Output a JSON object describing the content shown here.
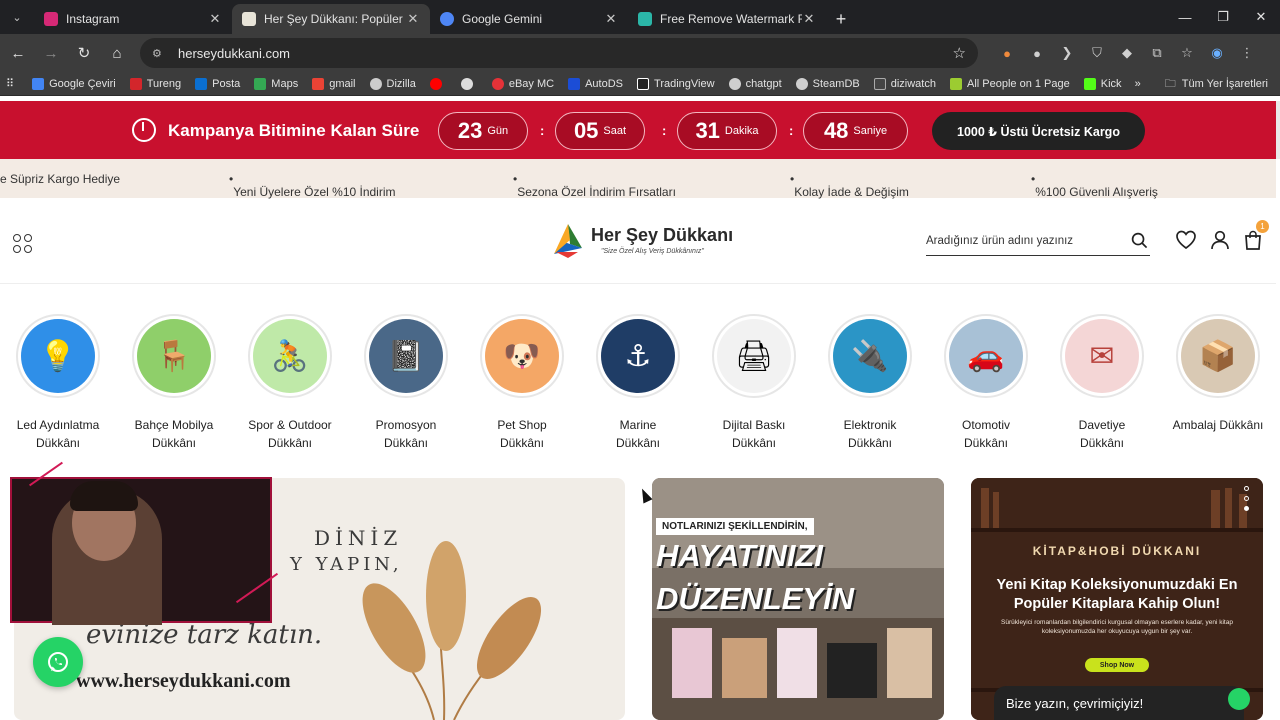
{
  "browser": {
    "tabs": [
      {
        "title": "Instagram",
        "favicon_color": "#d62976",
        "active": false
      },
      {
        "title": "Her Şey Dükkanı: Popüler Ürünl",
        "favicon_color": "#e8e4d8",
        "active": true
      },
      {
        "title": "Google Gemini",
        "favicon_color": "#4e86f5",
        "active": false
      },
      {
        "title": "Free Remove Watermark From",
        "favicon_color": "#2bb6a8",
        "active": false
      }
    ],
    "url": "herseydukkani.com",
    "bookmarks": [
      {
        "label": "Google Çeviri",
        "color": "#4285f4"
      },
      {
        "label": "Tureng",
        "color": "#d3262b"
      },
      {
        "label": "Posta",
        "color": "#0a6fd1"
      },
      {
        "label": "Maps",
        "color": "#34a853"
      },
      {
        "label": "gmail",
        "color": "#ea4335"
      },
      {
        "label": "Dizilla",
        "color": "#cccccc"
      },
      {
        "label": "",
        "color": "#ff0000"
      },
      {
        "label": "",
        "color": "#dddddd"
      },
      {
        "label": "eBay MC",
        "color": "#e53238"
      },
      {
        "label": "AutoDS",
        "color": "#1b4dd6"
      },
      {
        "label": "TradingView",
        "color": "#222222"
      },
      {
        "label": "chatgpt",
        "color": "#cfcfcf"
      },
      {
        "label": "SteamDB",
        "color": "#cfcfcf"
      },
      {
        "label": "diziwatch",
        "color": "#444444"
      },
      {
        "label": "All People on 1 Page",
        "color": "#9ccc31"
      },
      {
        "label": "Kick",
        "color": "#53fc18"
      }
    ],
    "bookmarks_folder": "Tüm Yer İşaretleri"
  },
  "campaign": {
    "title": "Kampanya Bitimine Kalan Süre",
    "countdown": [
      {
        "value": "23",
        "unit": "Gün"
      },
      {
        "value": "05",
        "unit": "Saat"
      },
      {
        "value": "31",
        "unit": "Dakika"
      },
      {
        "value": "48",
        "unit": "Saniye"
      }
    ],
    "separator": ":",
    "shipping": "1000 ₺ Üstü Ücretsiz Kargo"
  },
  "marquee": [
    "e Süpriz Kargo Hediye",
    "Yeni Üyelere Özel %10 İndirim",
    "Sezona Özel İndirim Fırsatları",
    "Kolay İade & Değişim",
    "%100 Güvenli Alışveriş"
  ],
  "header": {
    "logo_name": "Her Şey Dükkanı",
    "logo_slogan": "\"Size Özel Alış Veriş Dükkânınız\"",
    "search_placeholder": "Aradığınız ürün adını yazınız",
    "cart_count": "1"
  },
  "categories": [
    {
      "line1": "Led Aydınlatma",
      "line2": "Dükkânı",
      "bg": "#2f8fe8",
      "glyph": "💡"
    },
    {
      "line1": "Bahçe Mobilya",
      "line2": "Dükkânı",
      "bg": "#8fcf6a",
      "glyph": "🪑"
    },
    {
      "line1": "Spor & Outdoor",
      "line2": "Dükkânı",
      "bg": "#bfe9a8",
      "glyph": "🚴"
    },
    {
      "line1": "Promosyon",
      "line2": "Dükkânı",
      "bg": "#4a6888",
      "glyph": "📓"
    },
    {
      "line1": "Pet Shop",
      "line2": "Dükkânı",
      "bg": "#f4a766",
      "glyph": "🐶"
    },
    {
      "line1": "Marine",
      "line2": "Dükkânı",
      "bg": "#1f3d66",
      "glyph": "⚓"
    },
    {
      "line1": "Dijital Baskı",
      "line2": "Dükkânı",
      "bg": "#f2f2f2",
      "glyph": "🖨"
    },
    {
      "line1": "Elektronik",
      "line2": "Dükkânı",
      "bg": "#2b95c6",
      "glyph": "🔌"
    },
    {
      "line1": "Otomotiv",
      "line2": "Dükkânı",
      "bg": "#a8c1d6",
      "glyph": "🚗"
    },
    {
      "line1": "Davetiye",
      "line2": "Dükkânı",
      "bg": "#f4d6d6",
      "glyph": "✉"
    },
    {
      "line1": "Ambalaj Dükkânı",
      "line2": "",
      "bg": "#d9c9b4",
      "glyph": "📦"
    }
  ],
  "banners": {
    "b1": {
      "line1": "DİNİZ",
      "line2": "Y YAPIN,",
      "line3": "evinize tarz katın.",
      "line4": "www.herseydukkani.com"
    },
    "b2": {
      "ribbon": "NOTLARINIZI ŞEKİLLENDİRİN,",
      "big1": "HAYATINIZI",
      "big2": "DÜZENLEYİN"
    },
    "b3": {
      "brand": "KİTAP&HOBİ DÜKKANI",
      "headline": "Yeni Kitap Koleksiyonumuzdaki En Popüler Kitaplara Kahip Olun!",
      "small": "Sürükleyici romanlardan bilgilendirici kurgusal olmayan eserlere kadar, yeni kitap koleksiyonumuzda her okuyucuya uygun bir şey var.",
      "cta": "Shop Now"
    }
  },
  "chat": {
    "label": "Bize yazın, çevrimiçiyiz!"
  },
  "colors": {
    "campaign_red": "#c8102e",
    "marquee_bg": "#f3ebe4",
    "whatsapp": "#25d366"
  }
}
